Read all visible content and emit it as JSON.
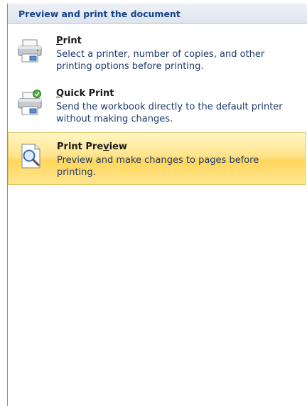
{
  "header": {
    "title": "Preview and print the document"
  },
  "items": [
    {
      "id": "print",
      "title_before": "",
      "title_key": "P",
      "title_after": "rint",
      "description": "Select a printer, number of copies, and other printing options before printing.",
      "icon": "printer-icon",
      "selected": false
    },
    {
      "id": "quick-print",
      "title_before": "",
      "title_key": "Q",
      "title_after": "uick Print",
      "description": "Send the workbook directly to the default printer without making changes.",
      "icon": "quick-print-icon",
      "selected": false
    },
    {
      "id": "print-preview",
      "title_before": "Print Pre",
      "title_key": "v",
      "title_after": "iew",
      "description": "Preview and make changes to pages before printing.",
      "icon": "print-preview-icon",
      "selected": true
    }
  ],
  "colors": {
    "header_text": "#15428b",
    "selected_bg": "#ffd65a",
    "description_text": "#1f3a6b"
  }
}
